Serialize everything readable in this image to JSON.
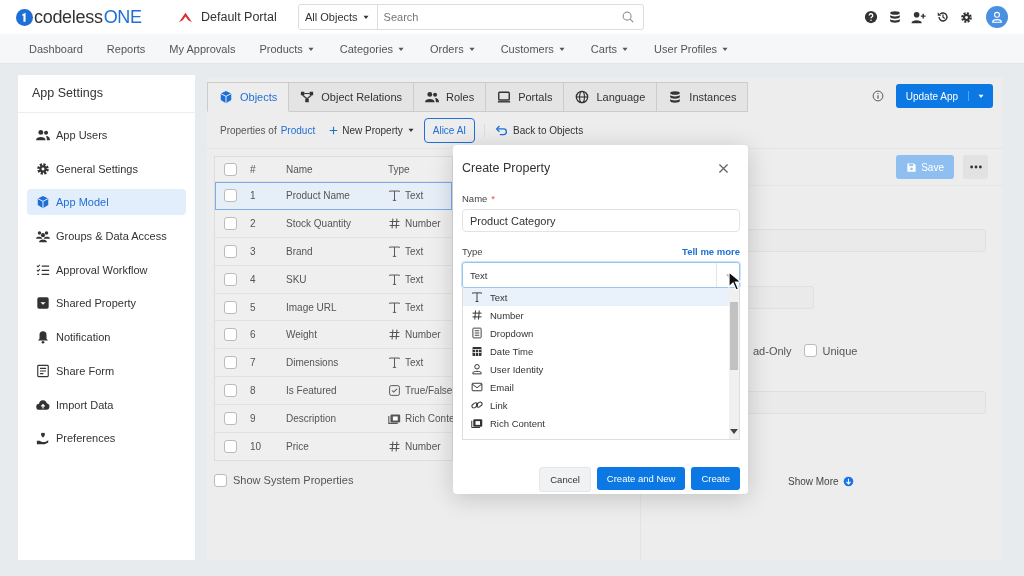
{
  "header": {
    "logo": {
      "text": "codeless",
      "accent": "ONE"
    },
    "portal": "Default Portal",
    "search": {
      "scope": "All Objects",
      "placeholder": "Search"
    }
  },
  "nav": [
    {
      "label": "Dashboard",
      "has_menu": false
    },
    {
      "label": "Reports",
      "has_menu": false
    },
    {
      "label": "My Approvals",
      "has_menu": false
    },
    {
      "label": "Products",
      "has_menu": true
    },
    {
      "label": "Categories",
      "has_menu": true
    },
    {
      "label": "Orders",
      "has_menu": true
    },
    {
      "label": "Customers",
      "has_menu": true
    },
    {
      "label": "Carts",
      "has_menu": true
    },
    {
      "label": "User Profiles",
      "has_menu": true
    }
  ],
  "sidebar": {
    "title": "App Settings",
    "items": [
      {
        "label": "App Users",
        "selected": false
      },
      {
        "label": "General Settings",
        "selected": false
      },
      {
        "label": "App Model",
        "selected": true
      },
      {
        "label": "Groups & Data Access",
        "selected": false
      },
      {
        "label": "Approval Workflow",
        "selected": false
      },
      {
        "label": "Shared Property",
        "selected": false
      },
      {
        "label": "Notification",
        "selected": false
      },
      {
        "label": "Share Form",
        "selected": false
      },
      {
        "label": "Import Data",
        "selected": false
      },
      {
        "label": "Preferences",
        "selected": false
      }
    ]
  },
  "tabs": [
    {
      "label": "Objects",
      "selected": true
    },
    {
      "label": "Object Relations",
      "selected": false
    },
    {
      "label": "Roles",
      "selected": false
    },
    {
      "label": "Portals",
      "selected": false
    },
    {
      "label": "Language",
      "selected": false
    },
    {
      "label": "Instances",
      "selected": false
    }
  ],
  "update_button": "Update App",
  "toolbar": {
    "prefix": "Properties of",
    "object": "Product",
    "new_property": "New Property",
    "alice": "Alice AI",
    "back": "Back to Objects"
  },
  "table": {
    "columns": [
      "#",
      "Name",
      "Type"
    ],
    "select_all_checked": false,
    "rows": [
      {
        "num": "1",
        "name": "Product Name",
        "type": "Text",
        "kind": "text",
        "selected": true,
        "checked": false
      },
      {
        "num": "2",
        "name": "Stock Quantity",
        "type": "Number",
        "kind": "number",
        "selected": false,
        "checked": false
      },
      {
        "num": "3",
        "name": "Brand",
        "type": "Text",
        "kind": "text",
        "selected": false,
        "checked": false
      },
      {
        "num": "4",
        "name": "SKU",
        "type": "Text",
        "kind": "text",
        "selected": false,
        "checked": false
      },
      {
        "num": "5",
        "name": "Image URL",
        "type": "Text",
        "kind": "text",
        "selected": false,
        "checked": false
      },
      {
        "num": "6",
        "name": "Weight",
        "type": "Number",
        "kind": "number",
        "selected": false,
        "checked": false
      },
      {
        "num": "7",
        "name": "Dimensions",
        "type": "Text",
        "kind": "text",
        "selected": false,
        "checked": false
      },
      {
        "num": "8",
        "name": "Is Featured",
        "type": "True/False",
        "kind": "boolean",
        "selected": false,
        "checked": false
      },
      {
        "num": "9",
        "name": "Description",
        "type": "Rich Conte",
        "kind": "rich",
        "selected": false,
        "checked": false
      },
      {
        "num": "10",
        "name": "Price",
        "type": "Number",
        "kind": "number",
        "selected": false,
        "checked": false
      }
    ]
  },
  "show_system": {
    "label": "Show System Properties",
    "checked": false
  },
  "details": {
    "save": "Save",
    "read_only_label": "ad-Only",
    "unique": {
      "label": "Unique",
      "checked": false
    },
    "show_more": "Show More"
  },
  "modal": {
    "title": "Create Property",
    "name_label": "Name",
    "required_mark": "*",
    "name_value": "Product Category",
    "type_label": "Type",
    "help_link": "Tell me more",
    "type_value": "Text",
    "options": [
      {
        "label": "Text",
        "kind": "text",
        "selected": true
      },
      {
        "label": "Number",
        "kind": "number",
        "selected": false
      },
      {
        "label": "Dropdown",
        "kind": "dropdown",
        "selected": false
      },
      {
        "label": "Date Time",
        "kind": "datetime",
        "selected": false
      },
      {
        "label": "User Identity",
        "kind": "user",
        "selected": false
      },
      {
        "label": "Email",
        "kind": "email",
        "selected": false
      },
      {
        "label": "Link",
        "kind": "link",
        "selected": false
      },
      {
        "label": "Rich Content",
        "kind": "rich",
        "selected": false
      }
    ],
    "buttons": {
      "cancel": "Cancel",
      "create_new": "Create and New",
      "create": "Create"
    }
  }
}
